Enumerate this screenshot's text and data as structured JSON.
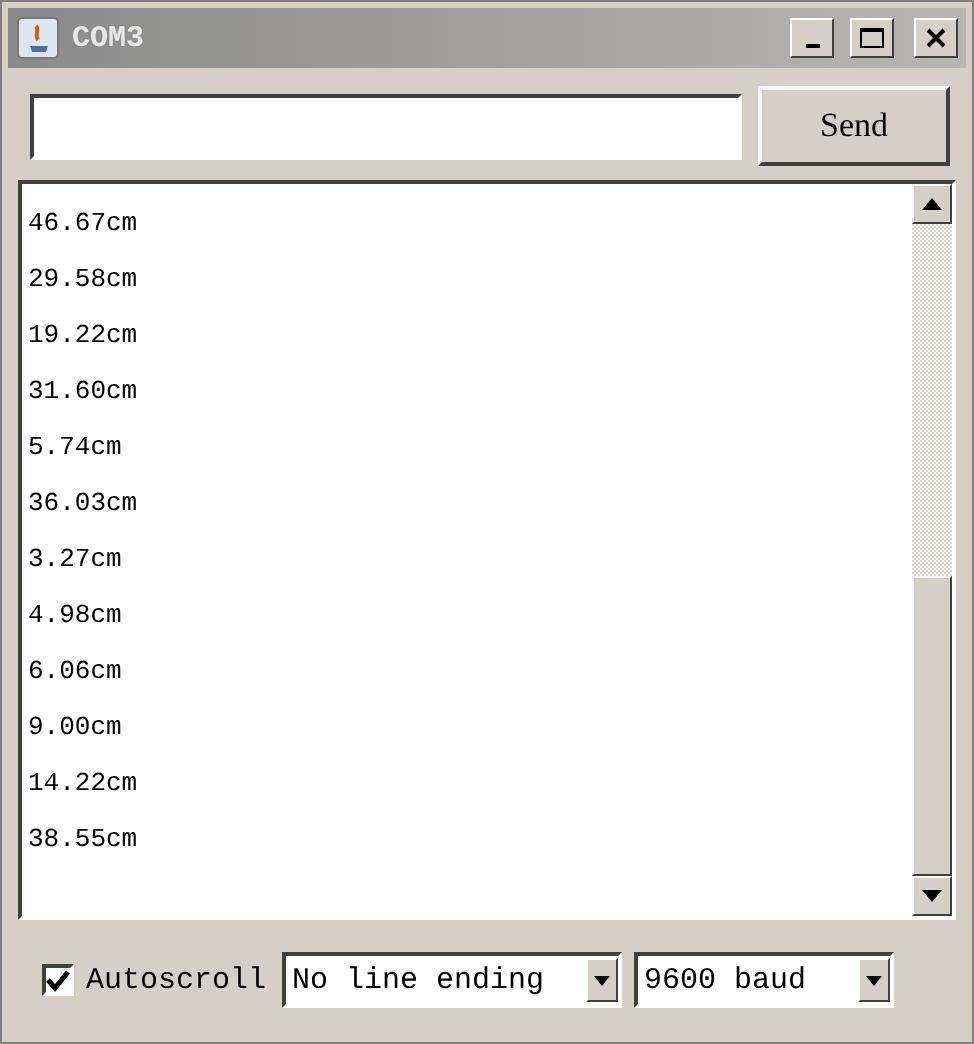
{
  "window": {
    "title": "COM3"
  },
  "send_row": {
    "button": "Send"
  },
  "output": {
    "lines": [
      "46.67cm",
      "29.58cm",
      "19.22cm",
      "31.60cm",
      "5.74cm",
      "36.03cm",
      "3.27cm",
      "4.98cm",
      "6.06cm",
      "9.00cm",
      "14.22cm",
      "38.55cm"
    ]
  },
  "footer": {
    "autoscroll": {
      "label": "Autoscroll",
      "checked": true
    },
    "line_ending": "No line ending",
    "baud": "9600 baud"
  }
}
